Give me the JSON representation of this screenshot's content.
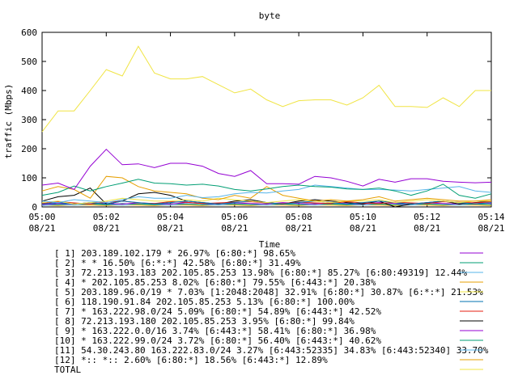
{
  "chart_data": {
    "type": "line",
    "title": "byte",
    "xlabel": "Time",
    "ylabel": "traffic (Mbps)",
    "ylim": [
      0,
      600
    ],
    "xlim": [
      "05:00",
      "05:14"
    ],
    "grid": false,
    "legend_placement": "bottom",
    "x": [
      "05:00",
      "05:00:30",
      "05:01",
      "05:01:30",
      "05:02",
      "05:02:30",
      "05:03",
      "05:03:30",
      "05:04",
      "05:04:30",
      "05:05",
      "05:05:30",
      "05:06",
      "05:06:30",
      "05:07",
      "05:07:30",
      "05:08",
      "05:08:30",
      "05:09",
      "05:09:30",
      "05:10",
      "05:10:30",
      "05:11",
      "05:11:30",
      "05:12",
      "05:12:30",
      "05:13",
      "05:13:30",
      "05:14"
    ],
    "x_ticks": [
      {
        "time": "05:00",
        "date": "08/21"
      },
      {
        "time": "05:02",
        "date": "08/21"
      },
      {
        "time": "05:04",
        "date": "08/21"
      },
      {
        "time": "05:06",
        "date": "08/21"
      },
      {
        "time": "05:08",
        "date": "08/21"
      },
      {
        "time": "05:10",
        "date": "08/21"
      },
      {
        "time": "05:12",
        "date": "08/21"
      },
      {
        "time": "05:14",
        "date": "08/21"
      }
    ],
    "y_ticks": [
      0,
      100,
      200,
      300,
      400,
      500,
      600
    ],
    "series": [
      {
        "name": "[ 1] 203.189.102.179 * 26.97%  [6:80:*] 98.65%",
        "color": "#9400d3",
        "values": [
          75,
          82,
          60,
          140,
          198,
          145,
          148,
          135,
          150,
          150,
          140,
          115,
          105,
          125,
          80,
          80,
          78,
          105,
          100,
          88,
          72,
          95,
          85,
          97,
          97,
          88,
          85,
          83,
          85
        ]
      },
      {
        "name": "[ 2] * * 16.50%  [6:*:*] 42.58%  [6:80:*] 31.49%",
        "color": "#009e73",
        "values": [
          40,
          50,
          72,
          55,
          70,
          82,
          95,
          82,
          80,
          75,
          78,
          72,
          60,
          55,
          62,
          70,
          75,
          70,
          68,
          62,
          60,
          65,
          55,
          40,
          55,
          78,
          40,
          30,
          45
        ]
      },
      {
        "name": "[ 3] 72.213.193.183 202.105.85.253 13.98%  [6:80:*] 85.27%  [6:80:49319] 12.44%",
        "color": "#56b4e9",
        "values": [
          20,
          15,
          25,
          20,
          15,
          25,
          35,
          30,
          30,
          40,
          32,
          35,
          45,
          50,
          48,
          55,
          60,
          75,
          70,
          65,
          60,
          60,
          58,
          55,
          60,
          65,
          70,
          55,
          50
        ]
      },
      {
        "name": "[ 4] * 202.105.85.253 8.02%  [6:80:*] 79.55%  [6:443:*] 20.38%",
        "color": "#e69f00",
        "values": [
          55,
          70,
          60,
          30,
          105,
          100,
          70,
          55,
          50,
          45,
          30,
          25,
          40,
          30,
          70,
          40,
          30,
          20,
          25,
          20,
          25,
          35,
          20,
          25,
          30,
          25,
          20,
          20,
          25
        ]
      },
      {
        "name": "[ 5] 203.189.96.0/19 * 7.03%  [1:2048:2048] 32.91%  [6:80:*] 30.87%  [6:*:*] 21.53%",
        "color": "#f0e442",
        "values": [
          15,
          20,
          10,
          15,
          20,
          30,
          25,
          20,
          20,
          25,
          20,
          30,
          25,
          20,
          15,
          20,
          25,
          20,
          15,
          20,
          20,
          25,
          15,
          20,
          25,
          20,
          15,
          20,
          20
        ]
      },
      {
        "name": "[ 6] 118.190.91.84 202.105.85.253 5.13%  [6:80:*] 100.00%",
        "color": "#0072b2",
        "values": [
          10,
          15,
          10,
          15,
          10,
          20,
          15,
          10,
          15,
          20,
          15,
          10,
          15,
          20,
          15,
          10,
          15,
          20,
          15,
          10,
          15,
          20,
          15,
          10,
          15,
          20,
          15,
          10,
          15
        ]
      },
      {
        "name": "[ 7] * 163.222.98.0/24 5.09%  [6:80:*] 54.89%  [6:443:*] 42.52%",
        "color": "#e51e10",
        "values": [
          12,
          18,
          14,
          10,
          16,
          20,
          14,
          12,
          18,
          16,
          12,
          14,
          16,
          18,
          14,
          12,
          16,
          14,
          12,
          18,
          14,
          12,
          16,
          14,
          12,
          18,
          16,
          14,
          18
        ]
      },
      {
        "name": "[ 8] 72.213.193.180 202.105.85.253 3.95%  [6:80:*] 99.84%",
        "color": "#000000",
        "values": [
          20,
          35,
          40,
          65,
          10,
          20,
          45,
          50,
          40,
          20,
          15,
          10,
          20,
          25,
          15,
          10,
          20,
          25,
          20,
          15,
          10,
          20,
          0,
          10,
          15,
          20,
          10,
          15,
          20
        ]
      },
      {
        "name": "[ 9] * 163.222.0.0/16 3.74%  [6:443:*] 58.41%  [6:80:*] 36.98%",
        "color": "#9400d3",
        "values": [
          8,
          12,
          10,
          15,
          12,
          10,
          14,
          12,
          10,
          15,
          12,
          10,
          14,
          12,
          10,
          15,
          12,
          10,
          14,
          12,
          10,
          15,
          12,
          10,
          14,
          12,
          10,
          15,
          12
        ]
      },
      {
        "name": "[10] * 163.222.99.0/24 3.72%  [6:80:*] 56.40%  [6:443:*] 40.62%",
        "color": "#009e73",
        "values": [
          10,
          8,
          12,
          10,
          8,
          12,
          10,
          8,
          12,
          10,
          8,
          12,
          10,
          8,
          12,
          10,
          8,
          12,
          10,
          8,
          12,
          10,
          8,
          12,
          10,
          8,
          12,
          10,
          8
        ]
      },
      {
        "name": "[11] 54.30.243.80 163.222.83.0/24 3.27%  [6:443:52335] 34.83%  [6:443:52340] 33.70%",
        "color": "#56b4e9",
        "values": [
          5,
          8,
          6,
          10,
          8,
          6,
          10,
          8,
          6,
          10,
          8,
          6,
          10,
          8,
          6,
          10,
          8,
          6,
          10,
          8,
          6,
          10,
          8,
          6,
          10,
          8,
          6,
          10,
          8
        ]
      },
      {
        "name": "[12] *:: *:: 2.60%  [6:80:*] 18.56%  [6:443:*] 12.89%",
        "color": "#e69f00",
        "values": [
          6,
          5,
          7,
          6,
          5,
          7,
          6,
          5,
          7,
          6,
          5,
          7,
          6,
          5,
          7,
          6,
          5,
          7,
          6,
          5,
          7,
          6,
          5,
          7,
          6,
          5,
          7,
          6,
          5
        ]
      },
      {
        "name": "TOTAL",
        "color": "#f0e442",
        "values": [
          258,
          330,
          330,
          400,
          472,
          450,
          552,
          460,
          440,
          440,
          448,
          420,
          392,
          405,
          368,
          345,
          365,
          368,
          368,
          350,
          375,
          418,
          345,
          345,
          342,
          375,
          345,
          400,
          400
        ]
      }
    ]
  }
}
